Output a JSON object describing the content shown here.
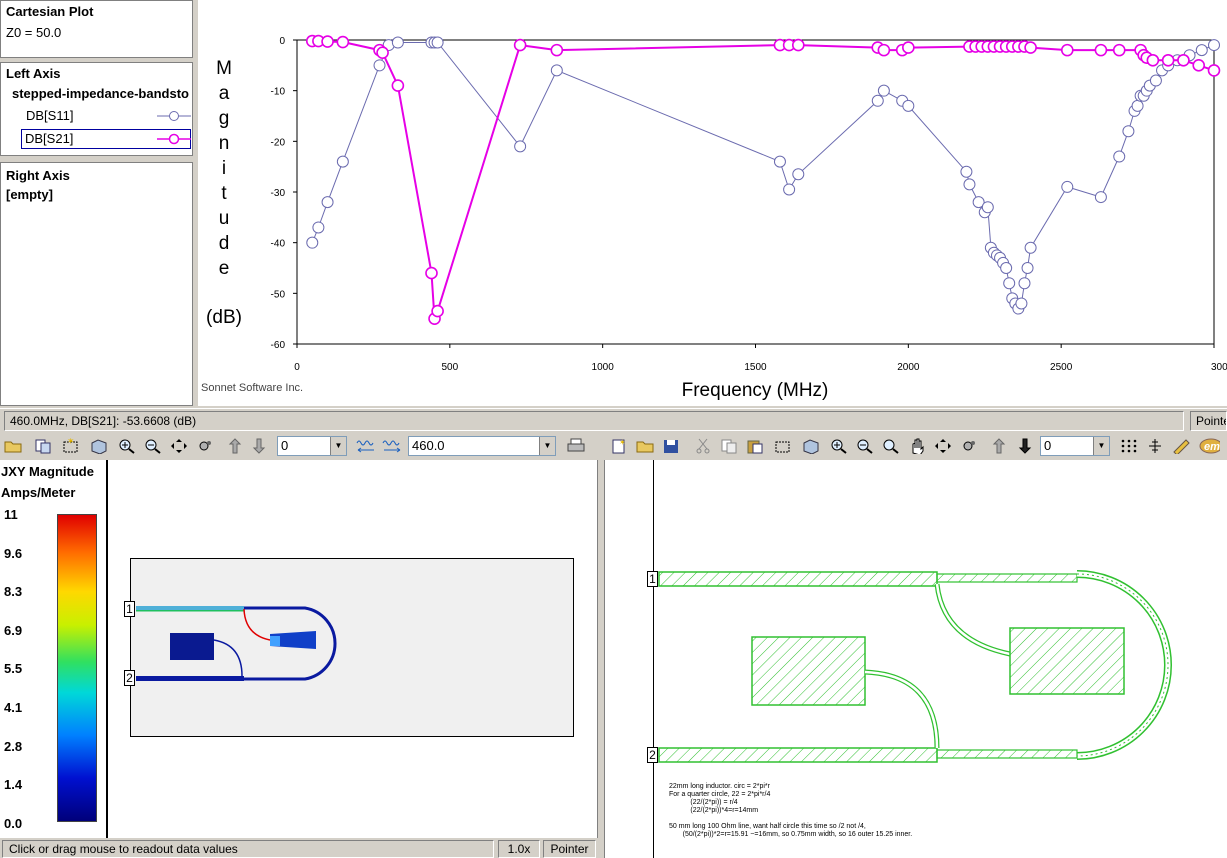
{
  "left_panel": {
    "plot_title": "Cartesian Plot",
    "z0": "Z0 = 50.0",
    "left_axis_title": "Left Axis",
    "project_name": "stepped-impedance-bandsto",
    "traces": [
      {
        "label": "DB[S11]",
        "color": "#6b6baf"
      },
      {
        "label": "DB[S21]",
        "color": "#e600e6"
      }
    ],
    "right_axis_title": "Right Axis",
    "right_axis_value": "[empty]"
  },
  "chart_data": {
    "type": "line",
    "xlabel": "Frequency (MHz)",
    "ylabel_letters": [
      "M",
      "a",
      "g",
      "n",
      "i",
      "t",
      "u",
      "d",
      "e"
    ],
    "ylabel_unit": "(dB)",
    "xlim": [
      0,
      3000
    ],
    "ylim": [
      -60,
      0
    ],
    "xticks": [
      0,
      500,
      1000,
      1500,
      2000,
      2500,
      3000
    ],
    "yticks": [
      0,
      -10,
      -20,
      -30,
      -40,
      -50,
      -60
    ],
    "credit": "Sonnet Software Inc.",
    "series": [
      {
        "name": "DB[S11]",
        "color": "#6b6baf",
        "x": [
          50,
          70,
          100,
          150,
          270,
          300,
          330,
          440,
          450,
          460,
          730,
          850,
          1580,
          1610,
          1640,
          1900,
          1920,
          1980,
          2000,
          2190,
          2200,
          2230,
          2250,
          2260,
          2270,
          2280,
          2290,
          2300,
          2310,
          2320,
          2330,
          2340,
          2350,
          2360,
          2370,
          2380,
          2390,
          2400,
          2520,
          2630,
          2690,
          2720,
          2740,
          2750,
          2760,
          2770,
          2780,
          2790,
          2810,
          2830,
          2850,
          2880,
          2920,
          2960,
          3000
        ],
        "y": [
          -40,
          -37,
          -32,
          -24,
          -5,
          -1,
          -0.5,
          -0.5,
          -0.5,
          -0.5,
          -21,
          -6,
          -24,
          -29.5,
          -26.5,
          -12,
          -10,
          -12,
          -13,
          -26,
          -28.5,
          -32,
          -34,
          -33,
          -41,
          -42,
          -42.5,
          -43,
          -44,
          -45,
          -48,
          -51,
          -52,
          -53,
          -52,
          -48,
          -45,
          -41,
          -29,
          -31,
          -23,
          -18,
          -14,
          -13,
          -11,
          -11,
          -10,
          -9,
          -8,
          -6,
          -5,
          -4,
          -3,
          -2,
          -1
        ]
      },
      {
        "name": "DB[S21]",
        "color": "#e600e6",
        "x": [
          50,
          70,
          100,
          150,
          270,
          280,
          330,
          440,
          450,
          460,
          730,
          850,
          1580,
          1610,
          1640,
          1900,
          1920,
          1980,
          2000,
          2200,
          2220,
          2240,
          2260,
          2280,
          2300,
          2320,
          2340,
          2360,
          2380,
          2400,
          2520,
          2630,
          2690,
          2760,
          2770,
          2780,
          2800,
          2850,
          2900,
          2950,
          3000
        ],
        "y": [
          -0.2,
          -0.2,
          -0.3,
          -0.4,
          -2,
          -2.5,
          -9,
          -46,
          -55,
          -53.5,
          -1,
          -2,
          -1,
          -1,
          -1,
          -1.5,
          -2,
          -2,
          -1.5,
          -1.3,
          -1.3,
          -1.3,
          -1.3,
          -1.3,
          -1.3,
          -1.3,
          -1.3,
          -1.3,
          -1.3,
          -1.5,
          -2,
          -2,
          -2,
          -2,
          -3,
          -3.5,
          -4,
          -4,
          -4,
          -5,
          -6
        ]
      }
    ]
  },
  "status": {
    "readout": "460.0MHz, DB[S21]: -53.6608  (dB)",
    "mode": "Pointe"
  },
  "current_view": {
    "layer_combo": "0",
    "frequency_combo": "460.0",
    "colorbar_title": "JXY Magnitude",
    "colorbar_unit": "Amps/Meter",
    "colorbar_ticks": [
      "11",
      "9.6",
      "8.3",
      "6.9",
      "5.5",
      "4.1",
      "2.8",
      "1.4",
      "0.0"
    ],
    "port_labels": [
      "1",
      "2"
    ],
    "status_text": "Click or drag mouse to readout data values",
    "zoom": "1.0x",
    "mode": "Pointer"
  },
  "layout_view": {
    "layer_combo": "0",
    "port_labels": [
      "1",
      "2"
    ],
    "notes": [
      "22mm long inductor. circ = 2*pi*r",
      "For a quarter circle, 22 = 2*pi*r/4",
      "           (22/(2*pi)) = r/4",
      "           (22/(2*pi))*4=r=14mm",
      "",
      "50 mm long 100 Ohm line, want half circle this time so /2 not /4,",
      "       (50/(2*pi))*2=r=15.91 ~=16mm, so 0.75mm width, so 16 outer 15.25 inner."
    ]
  }
}
